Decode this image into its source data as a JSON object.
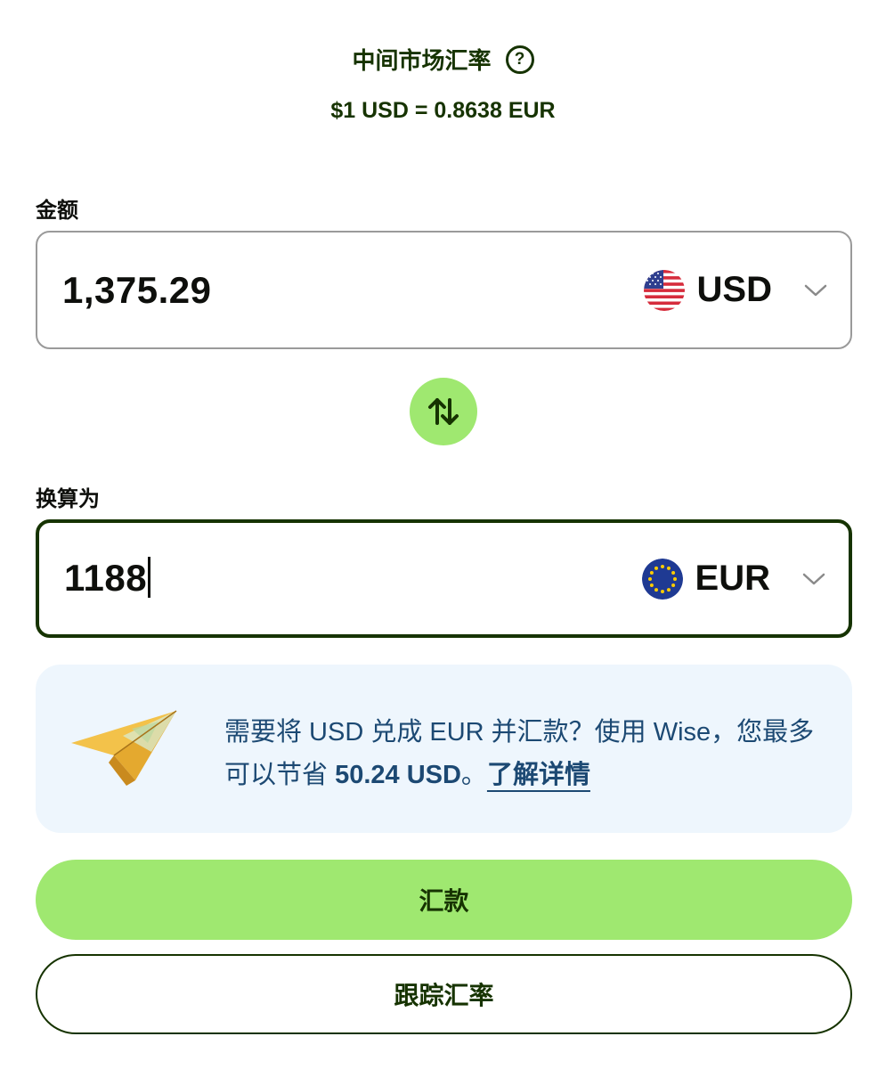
{
  "rate": {
    "title": "中间市场汇率",
    "help_icon": "question-circle-icon",
    "value": "$1 USD = 0.8638 EUR"
  },
  "amount": {
    "label": "金额",
    "value": "1,375.29",
    "currency": "USD",
    "flag_icon": "us-flag-icon"
  },
  "swap": {
    "icon": "swap-arrows-icon"
  },
  "convert": {
    "label": "换算为",
    "value": "1188",
    "currency": "EUR",
    "flag_icon": "eu-flag-icon"
  },
  "promo": {
    "text_before": "需要将 USD 兑成 EUR 并汇款？使用 Wise，您最多可以节省 ",
    "savings": "50.24 USD",
    "text_after": "。",
    "link": "了解详情",
    "illustration": "paper-plane-illustration"
  },
  "buttons": {
    "send": "汇款",
    "track": "跟踪汇率"
  },
  "colors": {
    "brand_green": "#9fe870",
    "forest_green": "#163300",
    "promo_bg": "#eef6fd",
    "promo_text": "#1c4973"
  }
}
